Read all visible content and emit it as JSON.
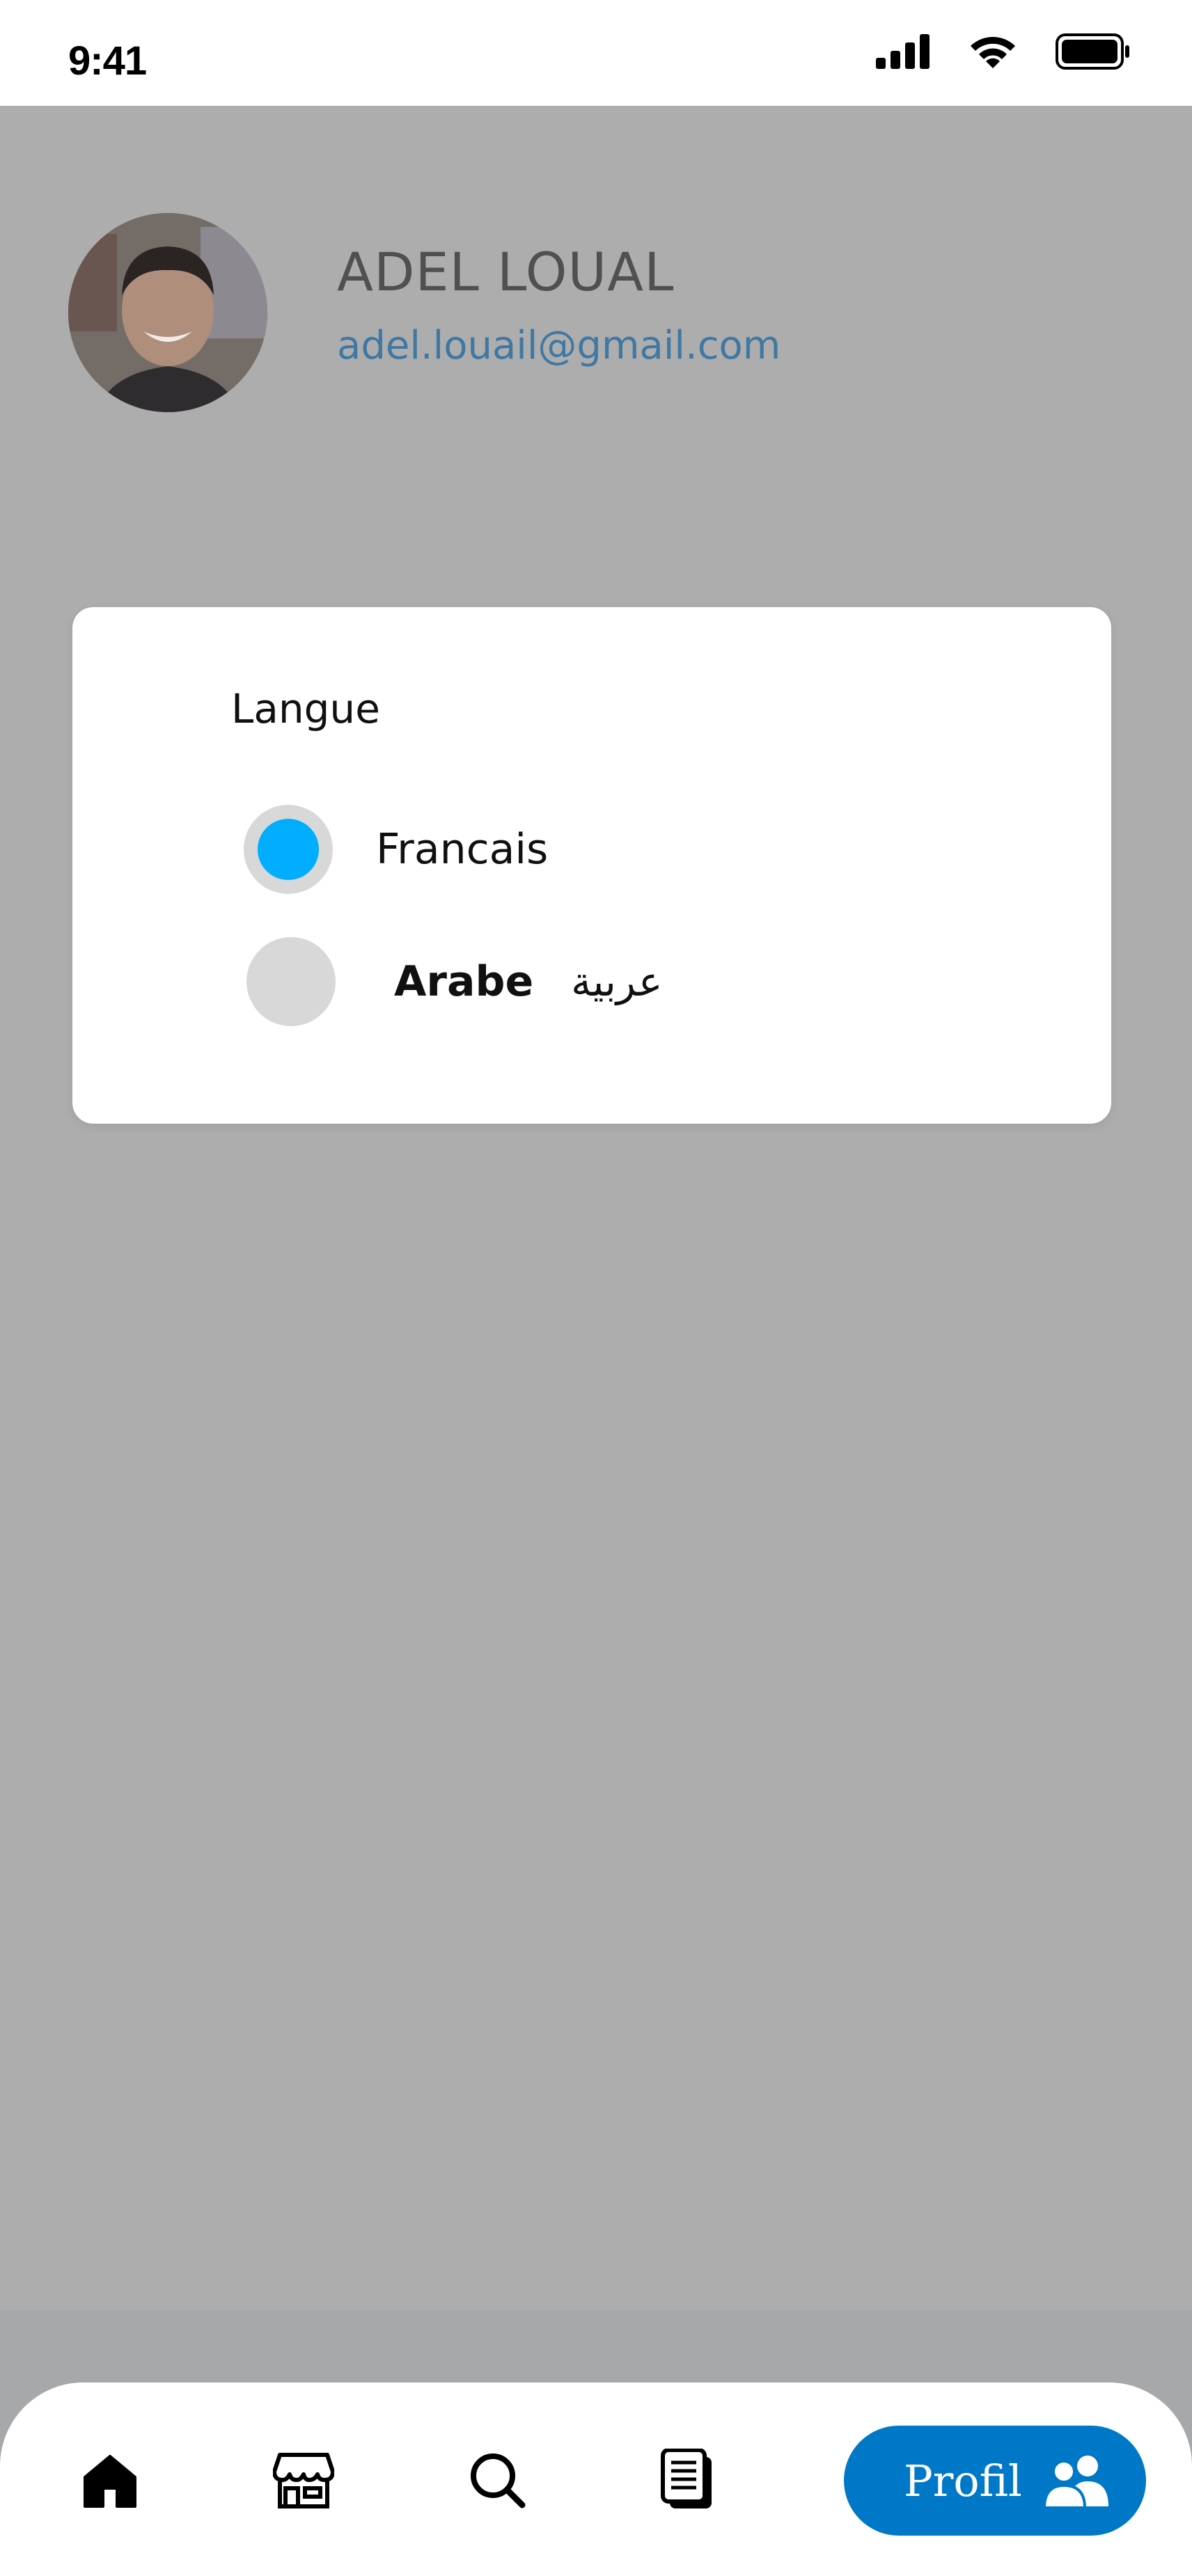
{
  "status_bar": {
    "time": "9:41"
  },
  "profile": {
    "name": "ADEL LOUAL",
    "email": "adel.louail@gmail.com"
  },
  "language_dialog": {
    "title": "Langue",
    "options": [
      {
        "label": "Francais",
        "label_native": "",
        "selected": true
      },
      {
        "label": "Arabe",
        "label_native": "عربية",
        "selected": false
      }
    ]
  },
  "bottom_nav": {
    "items": [
      {
        "icon": "home-icon"
      },
      {
        "icon": "store-icon"
      },
      {
        "icon": "search-icon"
      },
      {
        "icon": "documents-icon"
      }
    ],
    "active": {
      "label": "Profil",
      "icon": "users-icon"
    }
  },
  "colors": {
    "accent": "#0078c8",
    "radio_selected": "#00adff",
    "email": "#3f78a3",
    "overlay": "#adadad"
  }
}
